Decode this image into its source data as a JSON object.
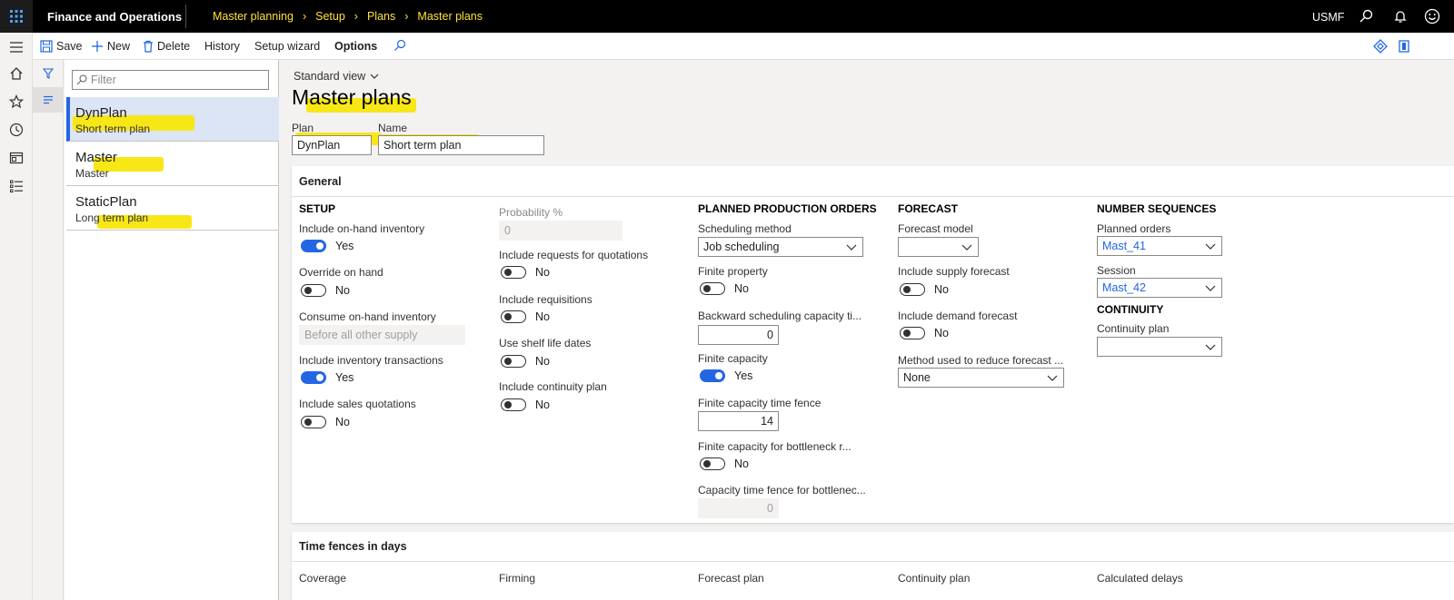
{
  "topbar": {
    "app_title": "Finance and Operations",
    "breadcrumb": [
      "Master planning",
      "Setup",
      "Plans",
      "Master plans"
    ],
    "company": "USMF",
    "icons": [
      "waffle-icon",
      "search-icon",
      "bell-icon",
      "smiley-icon"
    ]
  },
  "actions": {
    "save": "Save",
    "new": "New",
    "delete": "Delete",
    "history": "History",
    "setup_wizard": "Setup wizard",
    "options": "Options"
  },
  "list": {
    "filter_placeholder": "Filter",
    "items": [
      {
        "title": "DynPlan",
        "subtitle": "Short term plan",
        "selected": true
      },
      {
        "title": "Master",
        "subtitle": "Master",
        "selected": false
      },
      {
        "title": "StaticPlan",
        "subtitle": "Long term plan",
        "selected": false
      }
    ]
  },
  "header": {
    "view": "Standard view",
    "title": "Master plans",
    "plan_label": "Plan",
    "plan_value": "DynPlan",
    "name_label": "Name",
    "name_value": "Short term plan"
  },
  "general": {
    "title": "General",
    "setup": {
      "heading": "SETUP",
      "include_onhand_label": "Include on-hand inventory",
      "include_onhand_value": "Yes",
      "override_onhand_label": "Override on hand",
      "override_onhand_value": "No",
      "consume_onhand_label": "Consume on-hand inventory",
      "consume_onhand_value": "Before all other supply",
      "include_inv_trans_label": "Include inventory transactions",
      "include_inv_trans_value": "Yes",
      "include_sales_quot_label": "Include sales quotations",
      "include_sales_quot_value": "No"
    },
    "col2": {
      "probability_label": "Probability %",
      "probability_value": "0",
      "include_rfq_label": "Include requests for quotations",
      "include_rfq_value": "No",
      "include_req_label": "Include requisitions",
      "include_req_value": "No",
      "shelf_life_label": "Use shelf life dates",
      "shelf_life_value": "No",
      "continuity_label": "Include continuity plan",
      "continuity_value": "No"
    },
    "production": {
      "heading": "PLANNED PRODUCTION ORDERS",
      "sched_method_label": "Scheduling method",
      "sched_method_value": "Job scheduling",
      "finite_property_label": "Finite property",
      "finite_property_value": "No",
      "backward_label": "Backward scheduling capacity ti...",
      "backward_value": "0",
      "finite_capacity_label": "Finite capacity",
      "finite_capacity_value": "Yes",
      "finite_fence_label": "Finite capacity time fence",
      "finite_fence_value": "14",
      "bottleneck_label": "Finite capacity for bottleneck r...",
      "bottleneck_value": "No",
      "bottleneck_fence_label": "Capacity time fence for bottlenec...",
      "bottleneck_fence_value": "0"
    },
    "forecast": {
      "heading": "FORECAST",
      "model_label": "Forecast model",
      "model_value": "",
      "supply_label": "Include supply forecast",
      "supply_value": "No",
      "demand_label": "Include demand forecast",
      "demand_value": "No",
      "reduce_label": "Method used to reduce forecast ...",
      "reduce_value": "None"
    },
    "numseq": {
      "heading": "NUMBER SEQUENCES",
      "planned_orders_label": "Planned orders",
      "planned_orders_value": "Mast_41",
      "session_label": "Session",
      "session_value": "Mast_42",
      "continuity_heading": "CONTINUITY",
      "continuity_plan_label": "Continuity plan",
      "continuity_plan_value": ""
    }
  },
  "time_fences": {
    "title": "Time fences in days",
    "columns": [
      "Coverage",
      "Firming",
      "Forecast plan",
      "Continuity plan",
      "Calculated delays"
    ]
  },
  "colors": {
    "accent": "#2266e3",
    "highlight": "#f7e717",
    "breadcrumb": "#ffe135"
  }
}
